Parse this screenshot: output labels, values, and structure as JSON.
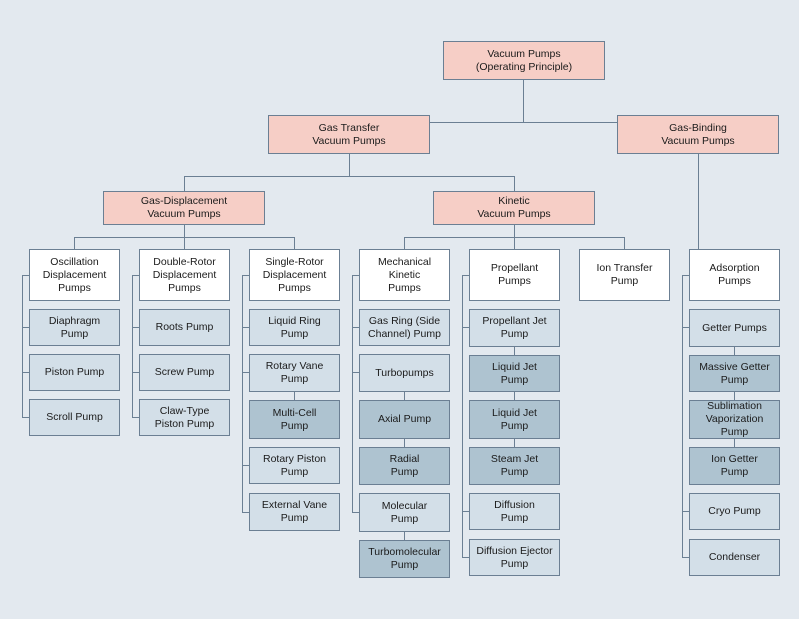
{
  "diagram": {
    "title": "Vacuum Pumps Classification by Operating Principle",
    "background_color": "#e3e9ef",
    "line_color": "#6b7f93",
    "palette": {
      "root_level": "#f6cec6",
      "category_header": "#ffffff",
      "leaf": "#d3dfe8",
      "subleaf": "#aec3d0"
    },
    "nodes": {
      "root": "Vacuum Pumps\n(Operating Principle)",
      "gas_transfer": "Gas Transfer\nVacuum Pumps",
      "gas_binding": "Gas-Binding\nVacuum Pumps",
      "gas_displacement": "Gas-Displacement\nVacuum Pumps",
      "kinetic": "Kinetic\nVacuum Pumps",
      "col1_header": "Oscillation\nDisplacement\nPumps",
      "col1_item1": "Diaphragm\nPump",
      "col1_item2": "Piston Pump",
      "col1_item3": "Scroll Pump",
      "col2_header": "Double-Rotor\nDisplacement\nPumps",
      "col2_item1": "Roots Pump",
      "col2_item2": "Screw Pump",
      "col2_item3": "Claw-Type\nPiston Pump",
      "col3_header": "Single-Rotor\nDisplacement\nPumps",
      "col3_item1": "Liquid Ring\nPump",
      "col3_item2": "Rotary Vane\nPump",
      "col3_item2_sub1": "Multi-Cell\nPump",
      "col3_item3": "Rotary Piston\nPump",
      "col3_item4": "External Vane\nPump",
      "col4_header": "Mechanical\nKinetic\nPumps",
      "col4_item1": "Gas Ring (Side\nChannel) Pump",
      "col4_item2": "Turbopumps",
      "col4_item2_sub1": "Axial Pump",
      "col4_item2_sub2": "Radial\nPump",
      "col4_item3": "Molecular\nPump",
      "col4_item3_sub1": "Turbomolecular\nPump",
      "col5_header": "Propellant\nPumps",
      "col5_item1": "Propellant Jet\nPump",
      "col5_item1_sub1": "Liquid Jet\nPump",
      "col5_item1_sub2": "Liquid Jet\nPump",
      "col5_item1_sub3": "Steam Jet\nPump",
      "col5_item2": "Diffusion\nPump",
      "col5_item3": "Diffusion Ejector\nPump",
      "col6_header": "Ion Transfer\nPump",
      "col7_header": "Adsorption\nPumps",
      "col7_item1": "Getter Pumps",
      "col7_item1_sub1": "Massive Getter\nPump",
      "col7_item1_sub2": "Sublimation\nVaporization Pump",
      "col7_item1_sub3": "Ion Getter\nPump",
      "col7_item2": "Cryo Pump",
      "col7_item3": "Condenser"
    }
  }
}
